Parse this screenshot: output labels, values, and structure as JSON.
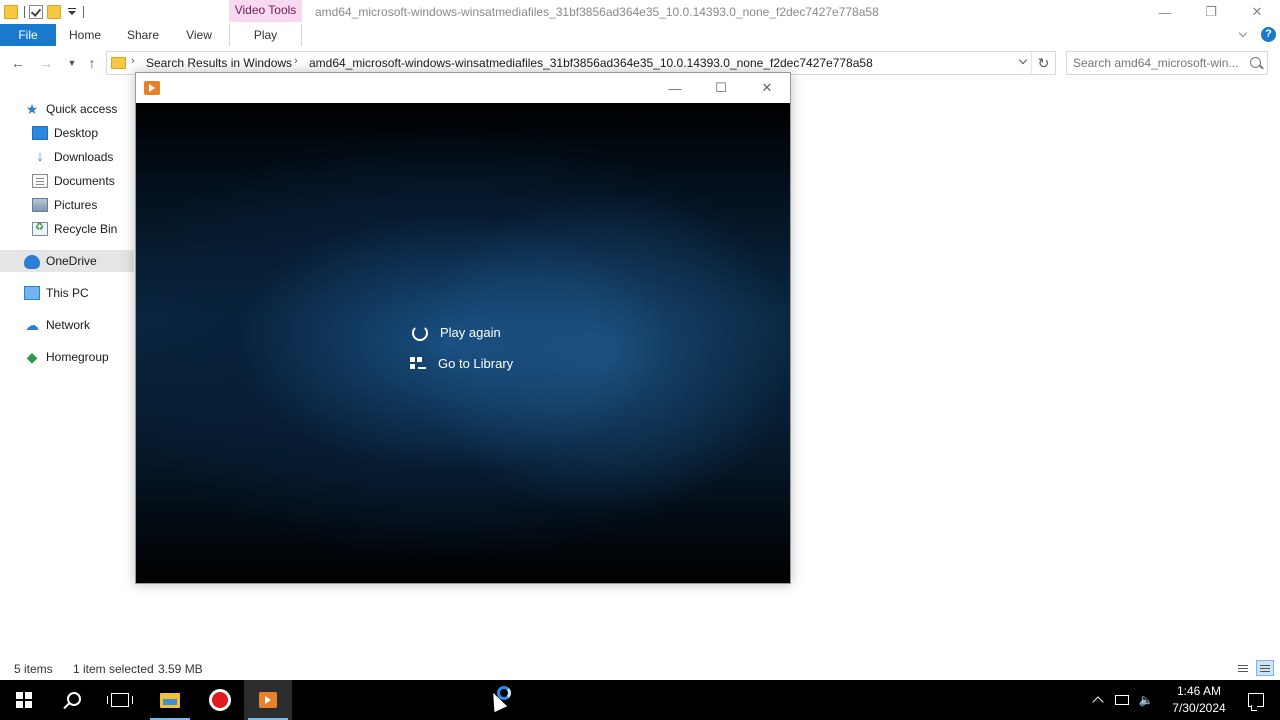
{
  "explorer": {
    "window_title": "amd64_microsoft-windows-winsatmediafiles_31bf3856ad364e35_10.0.14393.0_none_f2dec7427e778a58",
    "contextual_tab": "Video Tools",
    "ribbon_tabs": [
      {
        "label": "File"
      },
      {
        "label": "Home"
      },
      {
        "label": "Share"
      },
      {
        "label": "View"
      },
      {
        "label": "Play"
      }
    ],
    "address": {
      "segments": [
        "Search Results in Windows",
        "amd64_microsoft-windows-winsatmediafiles_31bf3856ad364e35_10.0.14393.0_none_f2dec7427e778a58"
      ]
    },
    "search": {
      "placeholder": "Search amd64_microsoft-win..."
    },
    "nav_items": [
      {
        "label": "Quick access",
        "icon": "star-icon"
      },
      {
        "label": "Desktop",
        "icon": "desktop-icon"
      },
      {
        "label": "Downloads",
        "icon": "download-icon"
      },
      {
        "label": "Documents",
        "icon": "documents-icon"
      },
      {
        "label": "Pictures",
        "icon": "pictures-icon"
      },
      {
        "label": "Recycle Bin",
        "icon": "recycle-bin-icon"
      },
      {
        "label": "OneDrive",
        "icon": "cloud-icon"
      },
      {
        "label": "This PC",
        "icon": "computer-icon"
      },
      {
        "label": "Network",
        "icon": "network-icon"
      },
      {
        "label": "Homegroup",
        "icon": "homegroup-icon"
      }
    ],
    "status": {
      "item_count": "5 items",
      "selection": "1 item selected",
      "size": "3.59 MB"
    }
  },
  "player": {
    "menu": [
      {
        "label": "Play again",
        "icon": "replay-icon"
      },
      {
        "label": "Go to Library",
        "icon": "library-icon"
      }
    ]
  },
  "taskbar": {
    "time": "1:46 AM",
    "date": "7/30/2024"
  },
  "colors": {
    "accent": "#1979ca",
    "video_tools_tab": "#f7d9f0",
    "selection": "#e5e5e5",
    "taskbar": "#000000"
  }
}
